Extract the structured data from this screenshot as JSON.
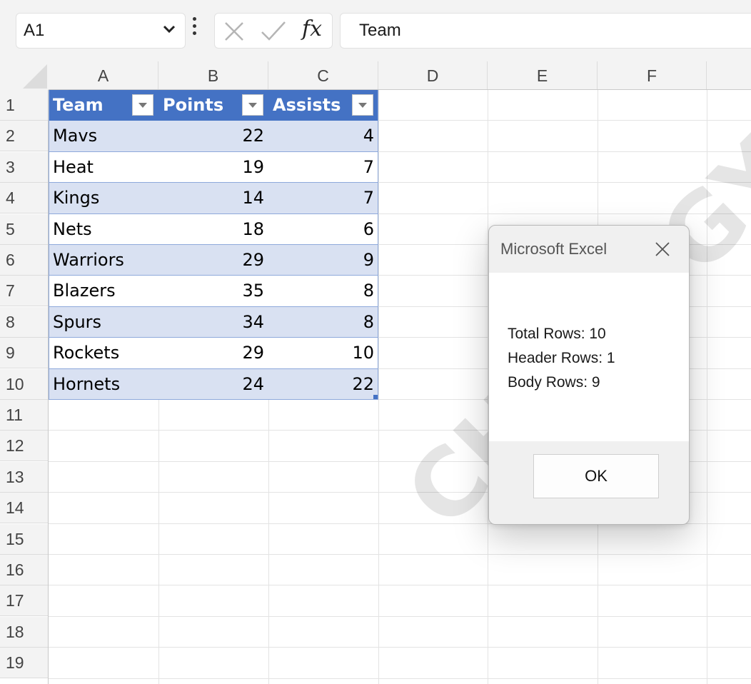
{
  "formula_bar": {
    "name_box": "A1",
    "formula_value": "Team",
    "fx_label": "fx"
  },
  "columns": [
    "A",
    "B",
    "C",
    "D",
    "E",
    "F"
  ],
  "rows": [
    "1",
    "2",
    "3",
    "4",
    "5",
    "6",
    "7",
    "8",
    "9",
    "10",
    "11",
    "12",
    "13",
    "14",
    "15",
    "16",
    "17",
    "18",
    "19"
  ],
  "table": {
    "headers": [
      "Team",
      "Points",
      "Assists"
    ],
    "data": [
      {
        "team": "Mavs",
        "points": "22",
        "assists": "4"
      },
      {
        "team": "Heat",
        "points": "19",
        "assists": "7"
      },
      {
        "team": "Kings",
        "points": "14",
        "assists": "7"
      },
      {
        "team": "Nets",
        "points": "18",
        "assists": "6"
      },
      {
        "team": "Warriors",
        "points": "29",
        "assists": "9"
      },
      {
        "team": "Blazers",
        "points": "35",
        "assists": "8"
      },
      {
        "team": "Spurs",
        "points": "34",
        "assists": "8"
      },
      {
        "team": "Rockets",
        "points": "29",
        "assists": "10"
      },
      {
        "team": "Hornets",
        "points": "24",
        "assists": "22"
      }
    ],
    "header_color": "#4472c4",
    "band_color": "#d9e1f2"
  },
  "dialog": {
    "title": "Microsoft Excel",
    "lines": [
      "Total Rows: 10",
      "Header Rows: 1",
      "Body Rows: 9"
    ],
    "ok_label": "OK"
  },
  "watermark": "CHOLOGY.CO"
}
